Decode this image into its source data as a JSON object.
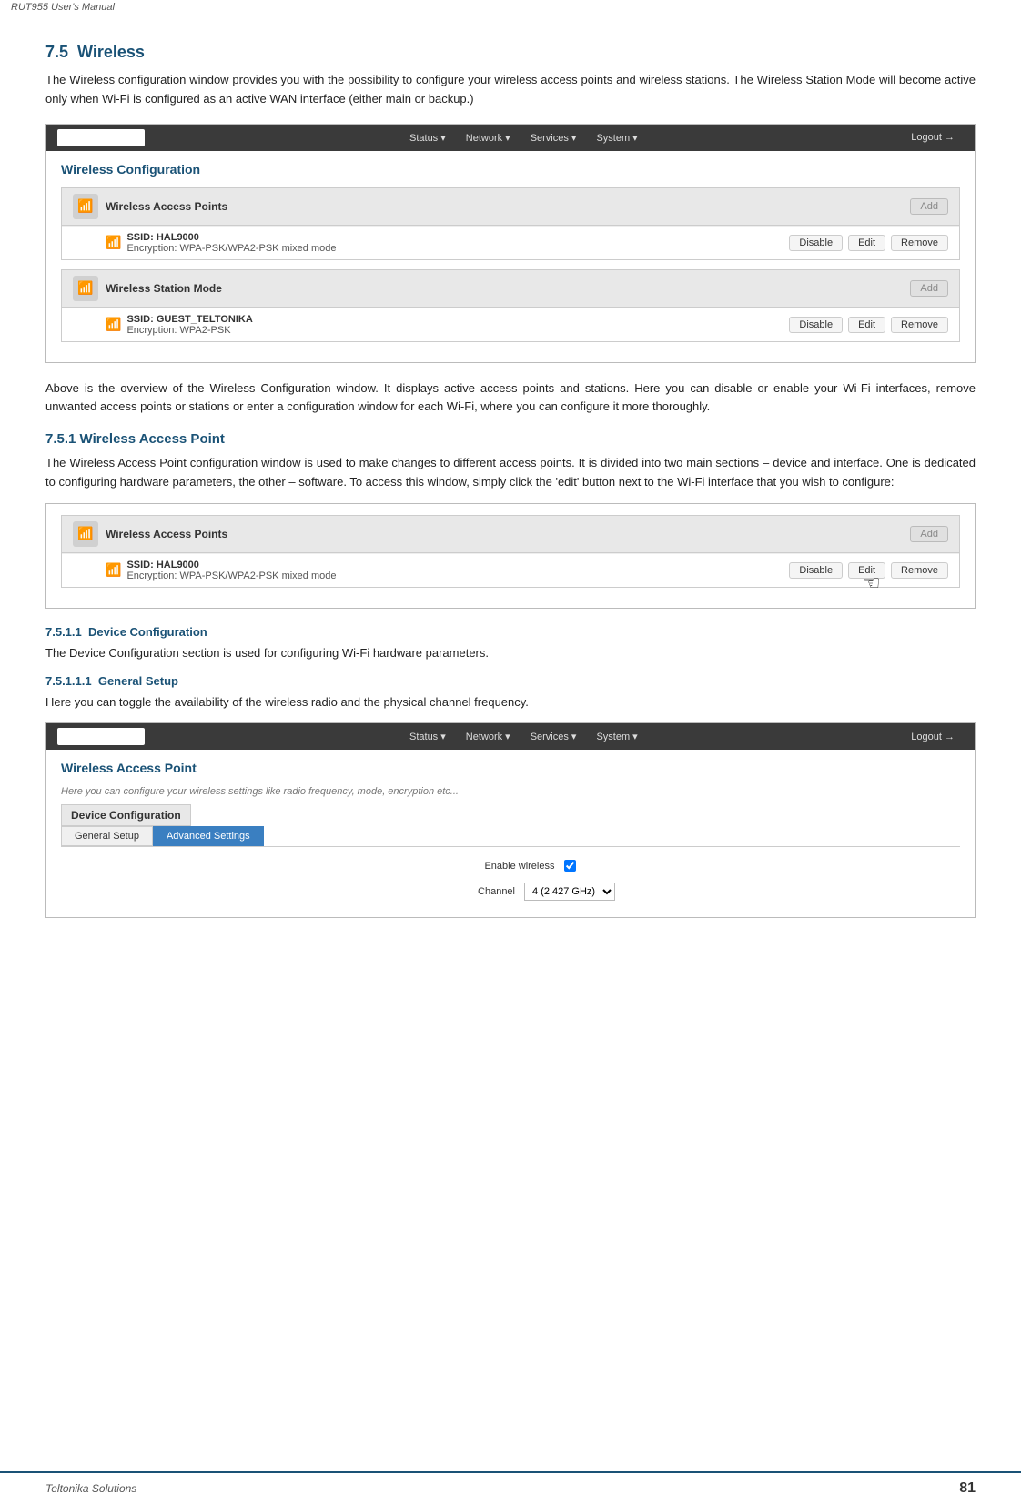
{
  "header": {
    "title": "RUT955 User's Manual"
  },
  "footer": {
    "company": "Teltonika Solutions",
    "page": "81"
  },
  "section75": {
    "number": "7.5",
    "title": "Wireless",
    "intro": "The Wireless configuration window provides you with the possibility to configure your wireless access points and wireless stations. The Wireless Station Mode will become active only when Wi-Fi is configured as an active WAN interface (either main or backup.)"
  },
  "wirelessConfigUI": {
    "navItems": [
      "Status",
      "Network",
      "Services",
      "System"
    ],
    "logoutLabel": "Logout",
    "sectionTitle": "Wireless Configuration",
    "panel1": {
      "title": "Wireless Access Points",
      "addBtn": "Add",
      "entry": {
        "ssid": "SSID: HAL9000",
        "encryption": "Encryption: WPA-PSK/WPA2-PSK mixed mode",
        "disableBtn": "Disable",
        "editBtn": "Edit",
        "removeBtn": "Remove"
      }
    },
    "panel2": {
      "title": "Wireless Station Mode",
      "addBtn": "Add",
      "entry": {
        "ssid": "SSID: GUEST_TELTONIKA",
        "encryption": "Encryption: WPA2-PSK",
        "disableBtn": "Disable",
        "editBtn": "Edit",
        "removeBtn": "Remove"
      }
    }
  },
  "bodyText1": "Above is the overview of the Wireless Configuration window. It displays active access points and stations. Here you can disable or enable your Wi-Fi interfaces, remove unwanted access points or stations or enter a configuration window for each Wi-Fi, where you can configure it more thoroughly.",
  "section751": {
    "number": "7.5.1",
    "title": "Wireless Access Point",
    "body": "The Wireless Access Point configuration window is used to make changes to different access points. It is divided into two main sections – device and interface. One is dedicated to configuring hardware parameters, the other – software. To access this window, simply click the 'edit' button next to the Wi-Fi interface that you wish to configure:"
  },
  "wirelessAPUI": {
    "panel": {
      "title": "Wireless Access Points",
      "addBtn": "Add",
      "entry": {
        "ssid": "SSID: HAL9000",
        "encryption": "Encryption: WPA-PSK/WPA2-PSK mixed mode",
        "disableBtn": "Disable",
        "editBtn": "Edit",
        "removeBtn": "Remove"
      }
    }
  },
  "section7511": {
    "number": "7.5.1.1",
    "title": "Device Configuration",
    "body": "The Device Configuration section is used for configuring Wi-Fi hardware parameters."
  },
  "section75111": {
    "number": "7.5.1.1.1",
    "title": "General Setup",
    "body": "Here you can toggle the availability of the wireless radio and the physical channel frequency."
  },
  "generalSetupUI": {
    "navItems": [
      "Status",
      "Network",
      "Services",
      "System"
    ],
    "logoutLabel": "Logout",
    "sectionTitle": "Wireless Access Point",
    "subtitle": "Here you can configure your wireless settings like radio frequency, mode, encryption etc...",
    "deviceConfigLabel": "Device Configuration",
    "tabs": [
      {
        "label": "General Setup",
        "active": false
      },
      {
        "label": "Advanced Settings",
        "active": true
      }
    ],
    "form": {
      "enableLabel": "Enable wireless",
      "enableChecked": true,
      "channelLabel": "Channel",
      "channelValue": "4 (2.427 GHz)"
    }
  }
}
